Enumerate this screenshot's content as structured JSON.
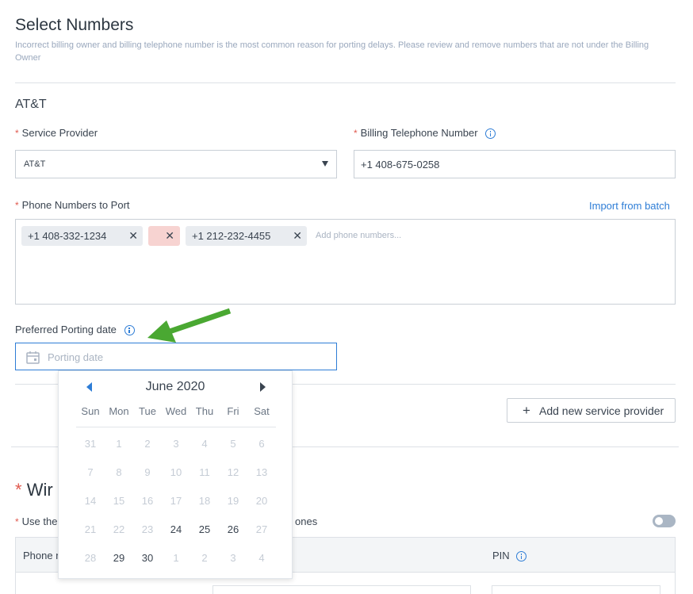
{
  "header": {
    "title": "Select Numbers",
    "subtitle": "Incorrect billing owner and billing telephone number is the most common reason for porting delays. Please review and remove numbers that are not under the Billing Owner"
  },
  "provider_section": {
    "name": "AT&T",
    "service_provider_label": "Service Provider",
    "service_provider_value": "AT&T",
    "btn_label": "Billing Telephone Number",
    "btn_value": "+1 408-675-0258",
    "phone_numbers_label": "Phone Numbers to Port",
    "import_link": "Import from batch",
    "chips": [
      {
        "value": "+1 408-332-1234",
        "state": "valid"
      },
      {
        "value": "",
        "state": "error"
      },
      {
        "value": "+1 212-232-4455",
        "state": "valid"
      }
    ],
    "phone_input_placeholder": "Add phone numbers...",
    "porting_date_label": "Preferred Porting date",
    "porting_date_placeholder": "Porting date"
  },
  "add_provider_button": "Add new service provider",
  "wireless_section": {
    "title_visible": "Wir",
    "use_label_visible": "Use the",
    "use_label_suffix_visible": "ones",
    "table_col_phone": "Phone n",
    "table_col_pin": "PIN"
  },
  "calendar": {
    "month_label": "June 2020",
    "weekdays": [
      "Sun",
      "Mon",
      "Tue",
      "Wed",
      "Thu",
      "Fri",
      "Sat"
    ],
    "weeks": [
      [
        {
          "d": "31",
          "s": "disabled"
        },
        {
          "d": "1",
          "s": "disabled"
        },
        {
          "d": "2",
          "s": "disabled"
        },
        {
          "d": "3",
          "s": "disabled"
        },
        {
          "d": "4",
          "s": "disabled"
        },
        {
          "d": "5",
          "s": "disabled"
        },
        {
          "d": "6",
          "s": "disabled"
        }
      ],
      [
        {
          "d": "7",
          "s": "disabled"
        },
        {
          "d": "8",
          "s": "disabled"
        },
        {
          "d": "9",
          "s": "disabled"
        },
        {
          "d": "10",
          "s": "disabled"
        },
        {
          "d": "11",
          "s": "disabled"
        },
        {
          "d": "12",
          "s": "disabled"
        },
        {
          "d": "13",
          "s": "disabled"
        }
      ],
      [
        {
          "d": "14",
          "s": "disabled"
        },
        {
          "d": "15",
          "s": "disabled"
        },
        {
          "d": "16",
          "s": "disabled"
        },
        {
          "d": "17",
          "s": "disabled"
        },
        {
          "d": "18",
          "s": "today"
        },
        {
          "d": "19",
          "s": "disabled"
        },
        {
          "d": "20",
          "s": "disabled"
        }
      ],
      [
        {
          "d": "21",
          "s": "disabled"
        },
        {
          "d": "22",
          "s": "disabled"
        },
        {
          "d": "23",
          "s": "disabled"
        },
        {
          "d": "24",
          "s": "active"
        },
        {
          "d": "25",
          "s": "active"
        },
        {
          "d": "26",
          "s": "active"
        },
        {
          "d": "27",
          "s": "disabled"
        }
      ],
      [
        {
          "d": "28",
          "s": "disabled"
        },
        {
          "d": "29",
          "s": "active"
        },
        {
          "d": "30",
          "s": "active"
        },
        {
          "d": "1",
          "s": "disabled"
        },
        {
          "d": "2",
          "s": "disabled"
        },
        {
          "d": "3",
          "s": "disabled"
        },
        {
          "d": "4",
          "s": "disabled"
        }
      ]
    ]
  },
  "colors": {
    "accent": "#2e7dd6",
    "required": "#e05a4f",
    "annotation_arrow": "#4aa832",
    "error_chip": "#f7d3d1"
  }
}
